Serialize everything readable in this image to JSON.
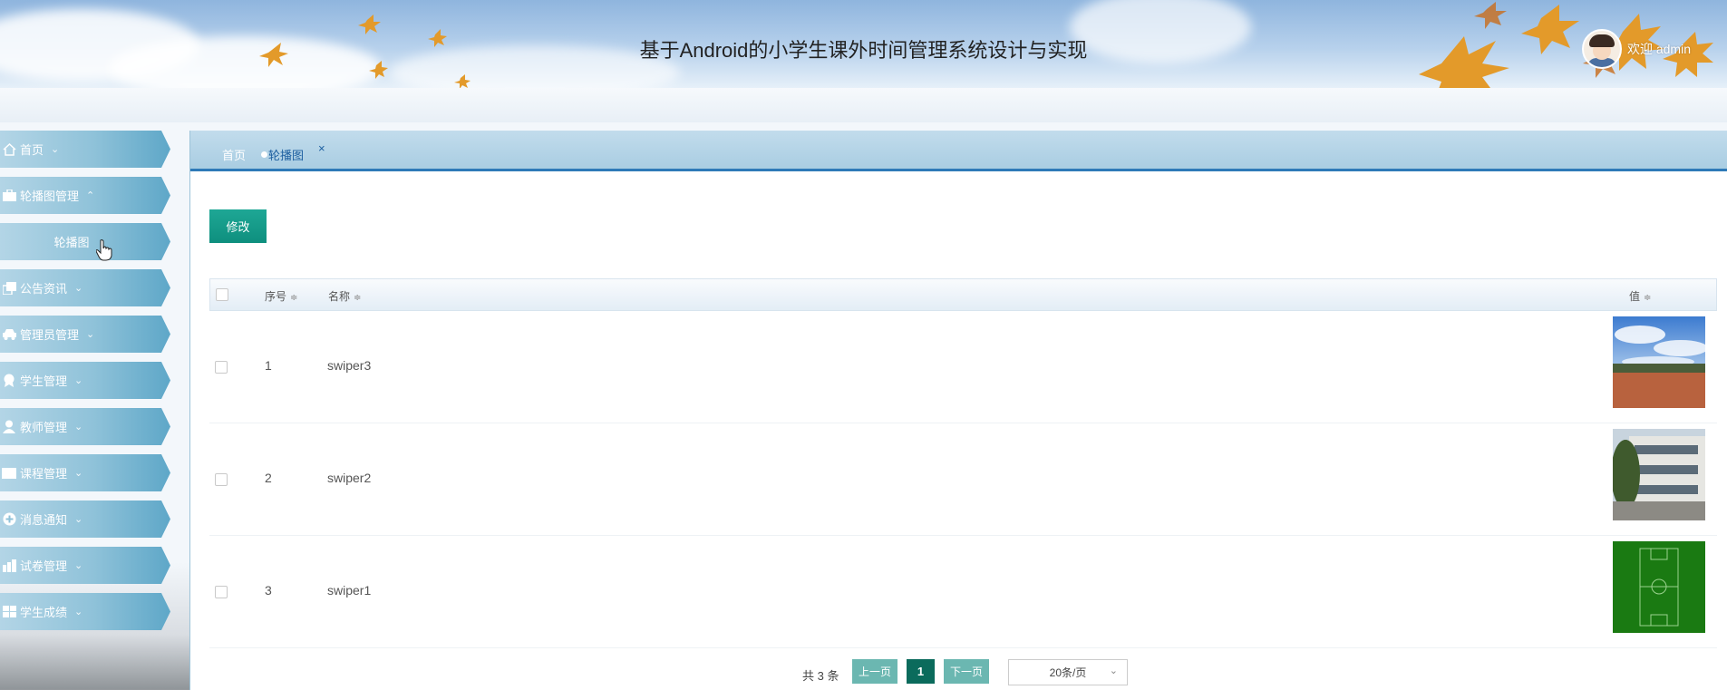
{
  "header": {
    "title": "基于Android的小学生课外时间管理系统设计与实现",
    "welcome": "欢迎 admin"
  },
  "sidebar": {
    "items": [
      {
        "label": "首页",
        "icon": "home-icon",
        "chevron": "⌄"
      },
      {
        "label": "轮播图管理",
        "icon": "briefcase-icon",
        "chevron": "⌃"
      },
      {
        "label": "轮播图",
        "icon": "",
        "chevron": ""
      },
      {
        "label": "公告资讯",
        "icon": "copy-icon",
        "chevron": "⌄"
      },
      {
        "label": "管理员管理",
        "icon": "car-icon",
        "chevron": "⌄"
      },
      {
        "label": "学生管理",
        "icon": "award-icon",
        "chevron": "⌄"
      },
      {
        "label": "教师管理",
        "icon": "user-icon",
        "chevron": "⌄"
      },
      {
        "label": "课程管理",
        "icon": "ticket-icon",
        "chevron": "⌄"
      },
      {
        "label": "消息通知",
        "icon": "plus-circle-icon",
        "chevron": "⌄"
      },
      {
        "label": "试卷管理",
        "icon": "bar-chart-icon",
        "chevron": "⌄"
      },
      {
        "label": "学生成绩",
        "icon": "table-icon",
        "chevron": "⌄"
      }
    ]
  },
  "tabs": {
    "home": "首页",
    "active": "轮播图",
    "close": "×"
  },
  "toolbar": {
    "edit_label": "修改"
  },
  "table": {
    "columns": {
      "index": "序号",
      "name": "名称",
      "value": "值",
      "sort": "≑"
    },
    "rows": [
      {
        "index": "1",
        "name": "swiper3",
        "thumb": "sky-playground-photo"
      },
      {
        "index": "2",
        "name": "swiper2",
        "thumb": "school-building-photo"
      },
      {
        "index": "3",
        "name": "swiper1",
        "thumb": "soccer-field-photo"
      }
    ]
  },
  "pagination": {
    "total": "共 3 条",
    "prev": "上一页",
    "current": "1",
    "next": "下一页",
    "page_size": "20条/页",
    "chevron": "⌄"
  },
  "colors": {
    "accent": "#0e8f7e",
    "sidebar": "#8fc2d9",
    "tab_border": "#2e7ab8"
  }
}
